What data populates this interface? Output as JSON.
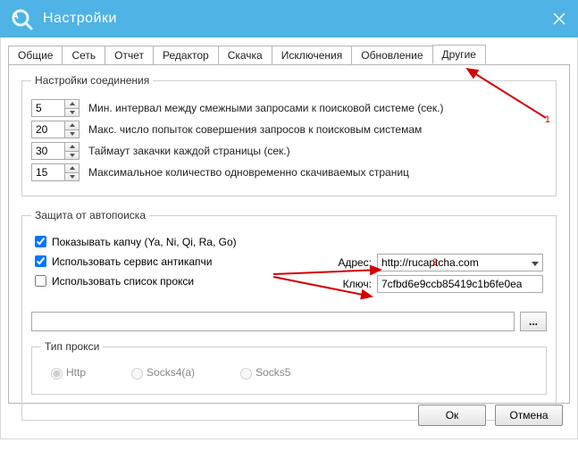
{
  "window": {
    "title": "Настройки",
    "close_icon": "×"
  },
  "tabs": {
    "t0": "Общие",
    "t1": "Сеть",
    "t2": "Отчет",
    "t3": "Редактор",
    "t4": "Скачка",
    "t5": "Исключения",
    "t6": "Обновление",
    "t7": "Другие"
  },
  "conn": {
    "legend": "Настройки соединения",
    "s0_val": "5",
    "s0_lbl": "Мин. интервал между смежными запросами к поисковой системе (сек.)",
    "s1_val": "20",
    "s1_lbl": "Макс. число попыток совершения запросов к поисковым системам",
    "s2_val": "30",
    "s2_lbl": "Таймаут закачки каждой страницы (сек.)",
    "s3_val": "15",
    "s3_lbl": "Максимальное количество одновременно скачиваемых страниц"
  },
  "auto": {
    "legend": "Защита от автопоиска",
    "chk0": "Показывать капчу (Ya, Ni, Qi, Ra, Go)",
    "chk1": "Использовать сервис антикапчи",
    "chk2": "Использовать список прокси",
    "addr_lbl": "Адрес:",
    "addr_val": "http://rucaptcha.com",
    "key_lbl": "Ключ:",
    "key_val": "7cfbd6e9ccb85419c1b6fe0ea",
    "browse": "...",
    "proxy_legend": "Тип прокси",
    "p0": "Http",
    "p1": "Socks4(a)",
    "p2": "Socks5"
  },
  "buttons": {
    "ok": "Ок",
    "cancel": "Отмена"
  },
  "annotations": {
    "a1": "1",
    "a2": "2"
  }
}
